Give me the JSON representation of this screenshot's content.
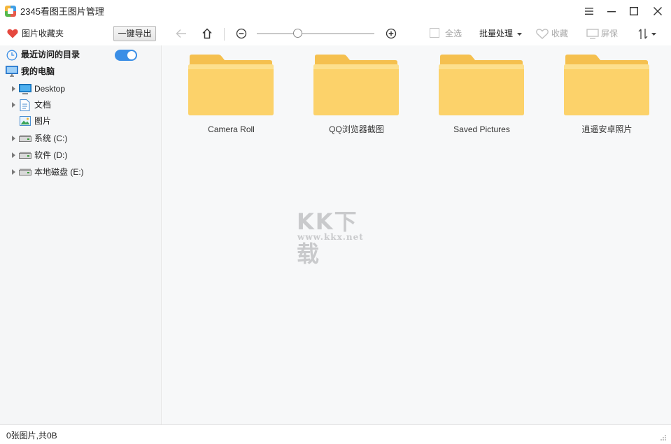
{
  "app": {
    "title": "2345看图王图片管理"
  },
  "toolbar": {
    "favorites_label": "图片收藏夹",
    "export_label": "一键导出",
    "select_all_label": "全选",
    "batch_label": "批量处理",
    "collect_label": "收藏",
    "screen_label": "屏保",
    "zoom_level": 0.35
  },
  "sidebar": {
    "recent_label": "最近访问的目录",
    "recent_toggle_on": true,
    "computer_label": "我的电脑",
    "items": [
      {
        "label": "Desktop",
        "icon": "desktop-icon",
        "expandable": true
      },
      {
        "label": "文档",
        "icon": "document-icon",
        "expandable": true
      },
      {
        "label": "图片",
        "icon": "picture-icon",
        "expandable": false
      },
      {
        "label": "系统 (C:)",
        "icon": "drive-icon",
        "expandable": true
      },
      {
        "label": "软件 (D:)",
        "icon": "drive-icon",
        "expandable": true
      },
      {
        "label": "本地磁盘 (E:)",
        "icon": "drive-icon",
        "expandable": true
      }
    ]
  },
  "folders": [
    {
      "name": "Camera Roll"
    },
    {
      "name": "QQ浏览器截图"
    },
    {
      "name": "Saved Pictures"
    },
    {
      "name": "逍遥安卓照片"
    }
  ],
  "watermark": {
    "text": "KK下载",
    "url": "www.kkx.net"
  },
  "status": {
    "text": "0张图片,共0B"
  },
  "colors": {
    "accent": "#3a8ee6",
    "folder": "#fcd26a",
    "heart": "#e5483e"
  }
}
